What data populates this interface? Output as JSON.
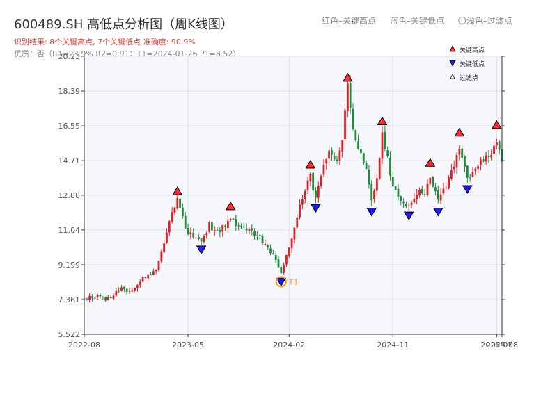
{
  "title": "600489.SH 高低点分析图（周K线图）",
  "subtitle": "识别结果: 8个关键高点, 7个关键低点  准确度: 90.9%",
  "quality_line": "优质：否（R1=23.9%  R2=0.91；T1=2024-01-26 P1=8.52）",
  "top_legend": {
    "red": "红色–关键高点",
    "blue": "蓝色–关键低点",
    "gray": "〇浅色–过滤点"
  },
  "colors": {
    "up": "#e01e24",
    "down": "#1e8a3c",
    "high_marker": "#ff2a2a",
    "low_marker": "#1a1aff",
    "t1_circle": "#f59a1b",
    "plot_bg": "#f5f7fa",
    "grid": "#dde2e8",
    "axis": "#333333"
  },
  "chart_data": {
    "type": "candlestick",
    "ylim": [
      5.522,
      20.23
    ],
    "y_ticks": [
      5.522,
      7.361,
      9.199,
      11.04,
      12.88,
      14.71,
      16.55,
      18.39,
      20.23
    ],
    "y_tick_labels": [
      "5.522",
      "7.361",
      "9.199",
      "11.04",
      "12.88",
      "14.71",
      "16.55",
      "18.39",
      "20.23"
    ],
    "x_ticks": [
      {
        "label": "2022-08",
        "week": 0
      },
      {
        "label": "2023-05",
        "week": 39
      },
      {
        "label": "2024-02",
        "week": 77
      },
      {
        "label": "2024-11",
        "week": 116
      },
      {
        "label": "2025-07",
        "week": 155
      },
      {
        "label": "2025-08",
        "week": 157
      }
    ],
    "x_range_weeks": [
      0,
      157
    ],
    "key_points": [
      {
        "type": "high",
        "week": 35,
        "price": 12.8
      },
      {
        "type": "low",
        "week": 44,
        "price": 10.3
      },
      {
        "type": "high",
        "week": 55,
        "price": 12.0
      },
      {
        "type": "low",
        "week": 74,
        "price": 8.6,
        "label": "T1"
      },
      {
        "type": "high",
        "week": 85,
        "price": 14.2
      },
      {
        "type": "low",
        "week": 87,
        "price": 12.5
      },
      {
        "type": "high",
        "week": 99,
        "price": 18.8
      },
      {
        "type": "low",
        "week": 108,
        "price": 12.3
      },
      {
        "type": "high",
        "week": 112,
        "price": 16.5
      },
      {
        "type": "low",
        "week": 122,
        "price": 12.1
      },
      {
        "type": "high",
        "week": 130,
        "price": 14.3
      },
      {
        "type": "low",
        "week": 133,
        "price": 12.3
      },
      {
        "type": "high",
        "week": 141,
        "price": 15.9
      },
      {
        "type": "low",
        "week": 144,
        "price": 13.5
      },
      {
        "type": "high",
        "week": 155,
        "price": 16.3
      }
    ],
    "legend": [
      {
        "symbol": "high",
        "label": "关键高点"
      },
      {
        "symbol": "low",
        "label": "关键低点"
      },
      {
        "symbol": "filtered",
        "label": "过滤点"
      }
    ]
  }
}
